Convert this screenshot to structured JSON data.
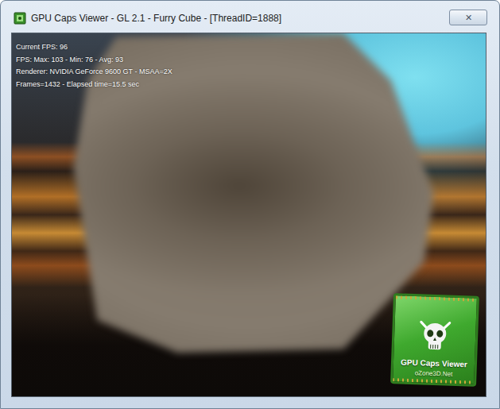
{
  "window": {
    "title": "GPU Caps Viewer - GL 2.1 - Furry Cube - [ThreadID=1888]",
    "close": "✕"
  },
  "hud": [
    "Current FPS: 96",
    "FPS: Max: 103 - Min: 76 - Avg: 93",
    "Renderer: NVIDIA GeForce 9600 GT - MSAA=2X",
    "Frames=1432 - Elapsed time=15.5 sec"
  ],
  "logo": {
    "title": "GPU Caps Viewer",
    "site": "oZone3D.Net"
  }
}
